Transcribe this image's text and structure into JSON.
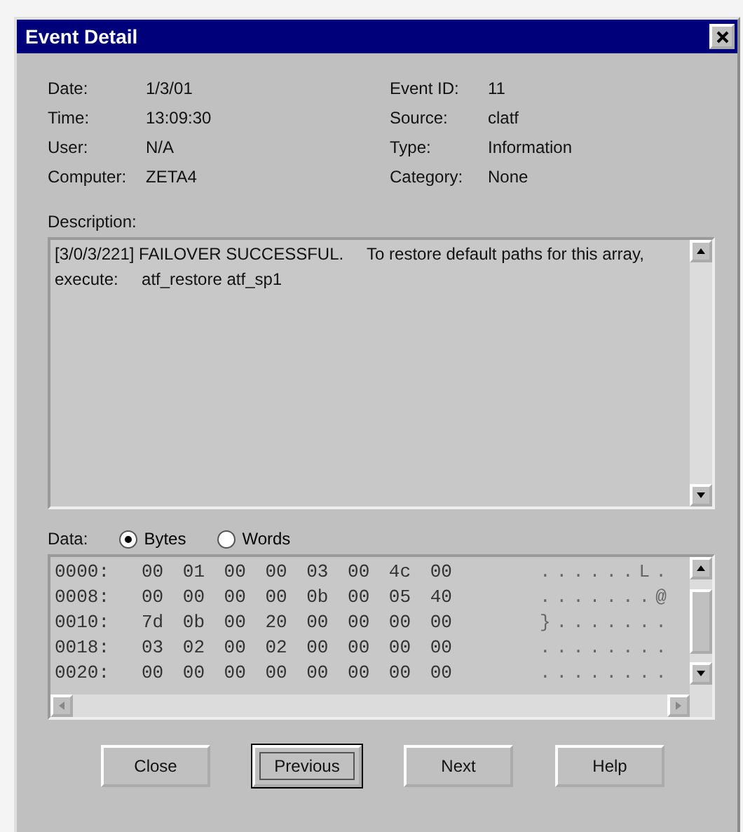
{
  "window": {
    "title": "Event Detail"
  },
  "fields_left": [
    {
      "label": "Date:",
      "value": "1/3/01"
    },
    {
      "label": "Time:",
      "value": "13:09:30"
    },
    {
      "label": "User:",
      "value": "N/A"
    },
    {
      "label": "Computer:",
      "value": "ZETA4"
    }
  ],
  "fields_right": [
    {
      "label": "Event ID:",
      "value": "11"
    },
    {
      "label": "Source:",
      "value": "clatf"
    },
    {
      "label": "Type:",
      "value": "Information"
    },
    {
      "label": "Category:",
      "value": "None"
    }
  ],
  "description": {
    "label": "Description:",
    "text": "[3/0/3/221] FAILOVER SUCCESSFUL.     To restore default paths for this array, execute:     atf_restore atf_sp1"
  },
  "data": {
    "label": "Data:",
    "formats": [
      {
        "label": "Bytes",
        "selected": true
      },
      {
        "label": "Words",
        "selected": false
      }
    ],
    "rows": [
      {
        "offset": "0000:",
        "bytes": "00 01 00 00 03 00 4c 00",
        "ascii": "......L."
      },
      {
        "offset": "0008:",
        "bytes": "00 00 00 00 0b 00 05 40",
        "ascii": ".......@"
      },
      {
        "offset": "0010:",
        "bytes": "7d 0b 00 20 00 00 00 00",
        "ascii": "}......."
      },
      {
        "offset": "0018:",
        "bytes": "03 02 00 02 00 00 00 00",
        "ascii": "........"
      },
      {
        "offset": "0020:",
        "bytes": "00 00 00 00 00 00 00 00",
        "ascii": "........"
      }
    ]
  },
  "buttons": [
    {
      "label": "Close",
      "focused": false
    },
    {
      "label": "Previous",
      "focused": true
    },
    {
      "label": "Next",
      "focused": false
    },
    {
      "label": "Help",
      "focused": false
    }
  ]
}
